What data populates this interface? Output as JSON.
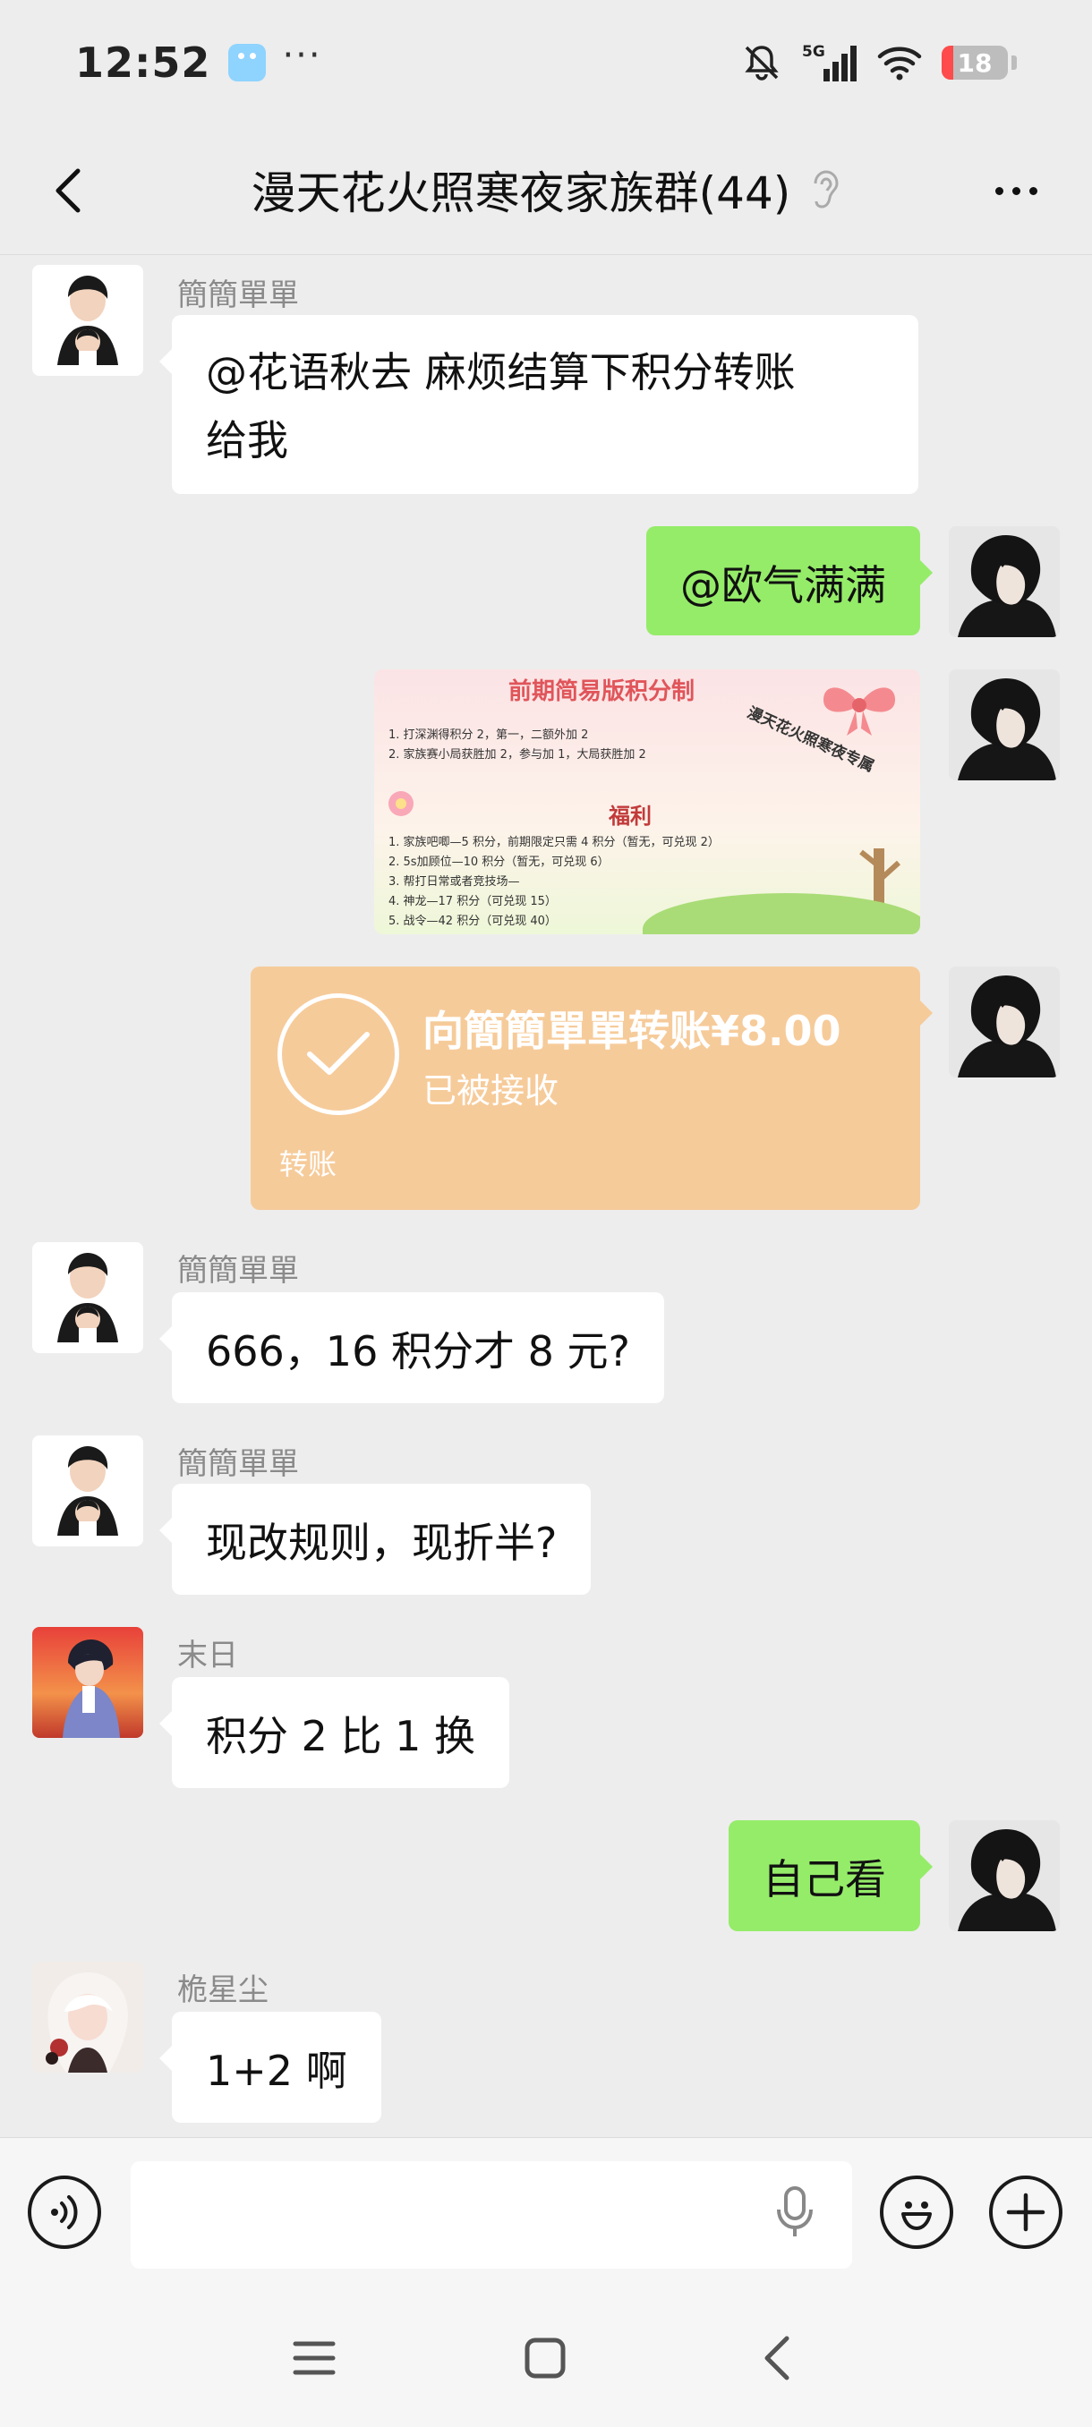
{
  "status_bar": {
    "time": "12:52",
    "more": "···",
    "network": "5G",
    "battery": "18",
    "battery_level": 0.18,
    "battery_color": "#ff4b4b"
  },
  "header": {
    "title": "漫天花火照寒夜家族群(44)",
    "back_icon": "chevron-left-icon",
    "mute_icon": "ear-icon",
    "more_icon": "more-dots-icon"
  },
  "messages": [
    {
      "side": "left",
      "sender": "簡簡單單",
      "text_lines": [
        "@花语秋去  麻烦结算下积分转账",
        "给我"
      ]
    },
    {
      "side": "right",
      "text": "@欧气满满"
    },
    {
      "side": "right",
      "type": "image",
      "image": {
        "title": "前期简易版积分制",
        "lines": [
          "1. 打深渊得积分 2，第一，二额外加 2",
          "2. 家族赛小局获胜加 2，参与加 1，大局获胜加 2"
        ],
        "stamp": "漫天花火照寒夜专属",
        "section": "福利",
        "benefits": [
          "1. 家族吧唧—5 积分，前期限定只需 4 积分（暂无，可兑现 2）",
          "2. 5s加顾位—10 积分（暂无，可兑现 6）",
          "3. 帮打日常或者竞技场—",
          "4. 神龙—17 积分（可兑现 15）",
          "5. 战令—42 积分（可兑现 40）"
        ]
      }
    },
    {
      "side": "right",
      "type": "transfer",
      "transfer": {
        "title": "向簡簡單單转账¥8.00",
        "status": "已被接收",
        "label": "转账"
      }
    },
    {
      "side": "left",
      "sender": "簡簡單單",
      "text": "666，16 积分才 8 元?"
    },
    {
      "side": "left",
      "sender": "簡簡單單",
      "text": "现改规则，现折半?"
    },
    {
      "side": "left",
      "sender": "末日",
      "text": "积分 2 比 1 换"
    },
    {
      "side": "right",
      "text": "自己看"
    },
    {
      "side": "left",
      "sender": "桅星尘",
      "text": "1+2 啊"
    }
  ],
  "input_bar": {
    "voice_icon": "voice-icon",
    "placeholder": "",
    "mic_icon": "mic-icon",
    "emoji_icon": "emoji-icon",
    "plus_icon": "plus-icon"
  },
  "nav_bar": {
    "menu_icon": "menu-icon",
    "home_icon": "home-square-icon",
    "back_icon": "back-triangle-icon"
  },
  "colors": {
    "background": "#ededed",
    "bubble_in": "#ffffff",
    "bubble_out": "#95ec69",
    "transfer": "#f6cb9a"
  }
}
